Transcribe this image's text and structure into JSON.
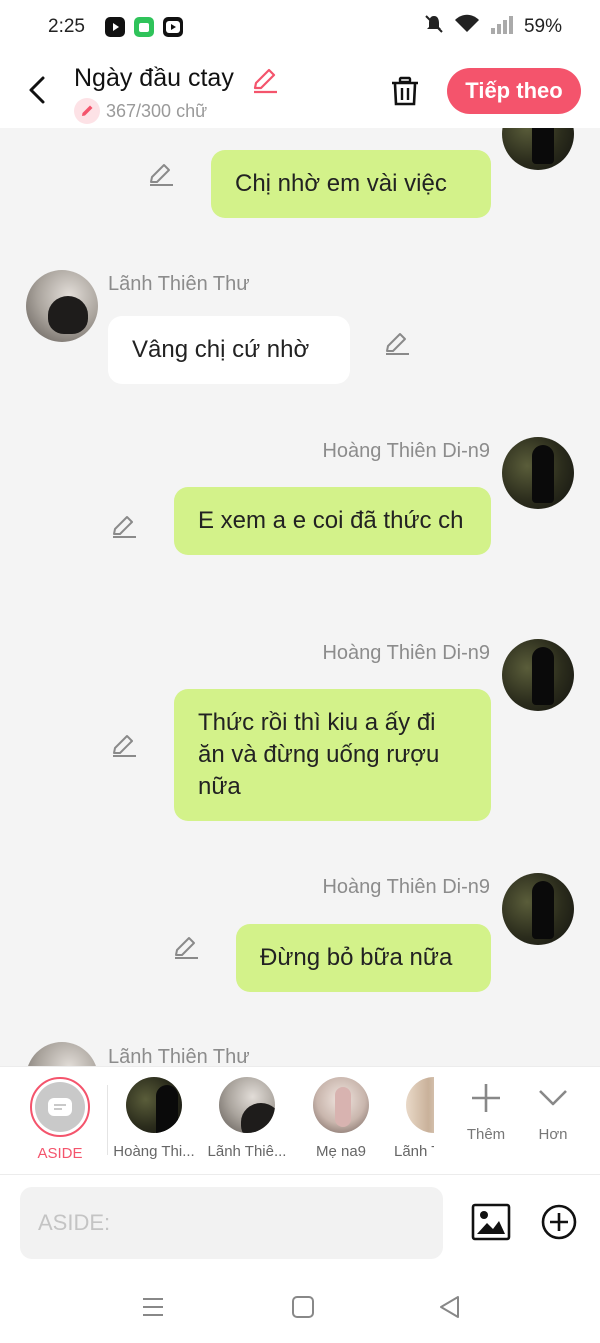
{
  "status_bar": {
    "time": "2:25",
    "battery": "59%",
    "app_icons": [
      "youtube-icon",
      "wechat-like-icon",
      "media-app-icon"
    ]
  },
  "header": {
    "title": "Ngày đầu ctay",
    "count": "367/300 chữ",
    "next_label": "Tiếp theo",
    "accent_color": "#f4546c"
  },
  "messages": [
    {
      "side": "right",
      "name": "",
      "text": "Chị nhờ em vài việc",
      "bubble_color": "#d3f28a"
    },
    {
      "side": "left",
      "name": "Lãnh Thiên Thư",
      "text": "Vâng chị cứ nhờ",
      "bubble_color": "#ffffff"
    },
    {
      "side": "right",
      "name": "Hoàng Thiên Di-n9",
      "text": "E xem a e coi đã thức ch",
      "bubble_color": "#d3f28a"
    },
    {
      "side": "right",
      "name": "Hoàng Thiên Di-n9",
      "text": "Thức rồi thì kiu a ấy đi ăn và đừng uống rượu nữa",
      "bubble_color": "#d3f28a"
    },
    {
      "side": "right",
      "name": "Hoàng Thiên Di-n9",
      "text": "Đừng bỏ bữa nữa",
      "bubble_color": "#d3f28a"
    },
    {
      "side": "left",
      "name": "Lãnh Thiên Thư",
      "text": "",
      "bubble_color": "#ffffff"
    }
  ],
  "characters": {
    "aside_label": "ASIDE",
    "items": [
      {
        "label": "Hoàng Thi..."
      },
      {
        "label": "Lãnh Thiê..."
      },
      {
        "label": "Mẹ na9"
      },
      {
        "label": "Lãnh T"
      }
    ],
    "more_label": "Thêm",
    "expand_label": "Hơn"
  },
  "input": {
    "placeholder": "ASIDE:"
  }
}
